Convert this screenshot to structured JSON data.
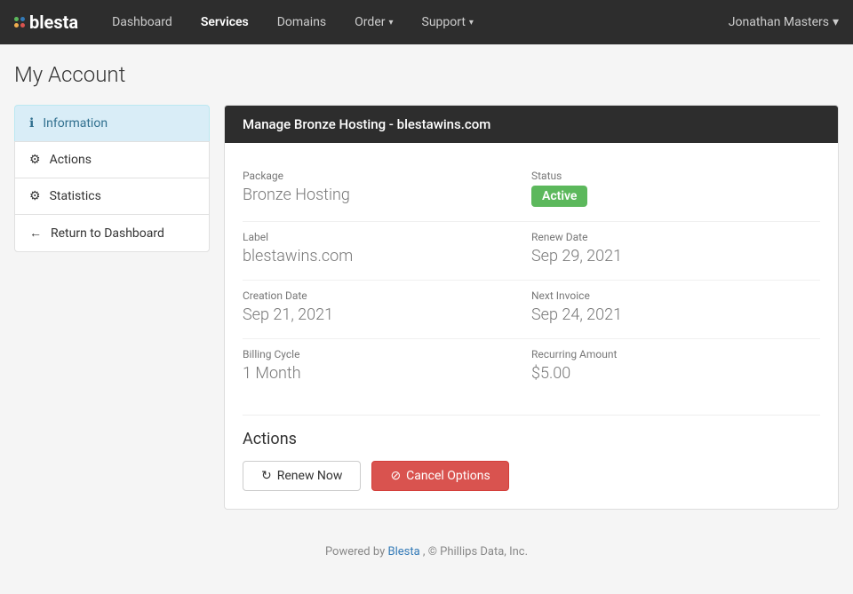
{
  "brand": {
    "name": "blesta",
    "logo_alt": "blesta logo"
  },
  "topnav": {
    "links": [
      {
        "label": "Dashboard",
        "active": false,
        "has_dropdown": false
      },
      {
        "label": "Services",
        "active": true,
        "has_dropdown": false
      },
      {
        "label": "Domains",
        "active": false,
        "has_dropdown": false
      },
      {
        "label": "Order",
        "active": false,
        "has_dropdown": true
      },
      {
        "label": "Support",
        "active": false,
        "has_dropdown": true
      }
    ],
    "user": "Jonathan Masters"
  },
  "page": {
    "title": "My Account"
  },
  "sidebar": {
    "items": [
      {
        "label": "Information",
        "icon": "ℹ",
        "active": true
      },
      {
        "label": "Actions",
        "icon": "⚙",
        "active": false
      },
      {
        "label": "Statistics",
        "icon": "⚙",
        "active": false
      },
      {
        "label": "Return to Dashboard",
        "icon": "←",
        "active": false
      }
    ]
  },
  "panel": {
    "header": "Manage Bronze Hosting - blestawins.com",
    "fields": {
      "package_label": "Package",
      "package_value": "Bronze Hosting",
      "status_label": "Status",
      "status_value": "Active",
      "label_label": "Label",
      "label_value": "blestawins.com",
      "renew_date_label": "Renew Date",
      "renew_date_value": "Sep 29, 2021",
      "creation_date_label": "Creation Date",
      "creation_date_value": "Sep 21, 2021",
      "next_invoice_label": "Next Invoice",
      "next_invoice_value": "Sep 24, 2021",
      "billing_cycle_label": "Billing Cycle",
      "billing_cycle_value": "1 Month",
      "recurring_amount_label": "Recurring Amount",
      "recurring_amount_value": "$5.00"
    },
    "actions_section_title": "Actions",
    "buttons": {
      "renew_now": "Renew Now",
      "cancel_options": "Cancel Options"
    }
  },
  "footer": {
    "powered_by": "Powered by",
    "brand_link": "Blesta",
    "suffix": ", © Phillips Data, Inc."
  }
}
